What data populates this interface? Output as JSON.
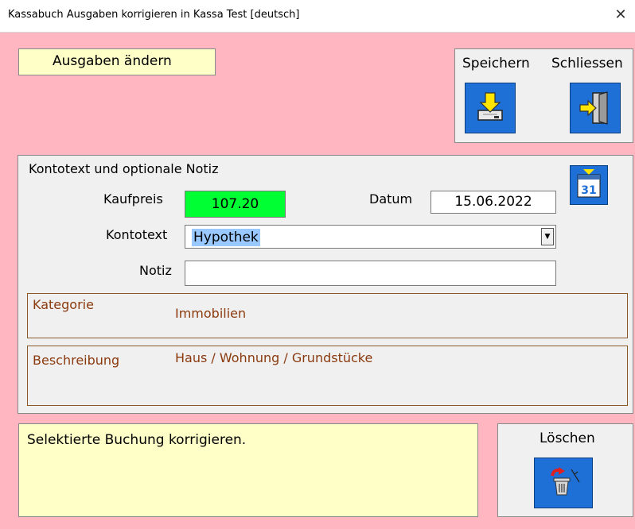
{
  "window": {
    "title": "Kassabuch Ausgaben korrigieren in Kassa Test   [deutsch]",
    "close_symbol": "✕"
  },
  "mode_label": "Ausgaben ändern",
  "buttons": {
    "save_label": "Speichern",
    "close_label": "Schliessen",
    "delete_label": "Löschen"
  },
  "form": {
    "section_title": "Kontotext und optionale Notiz",
    "price_label": "Kaufpreis",
    "price_value": "107.20",
    "date_label": "Datum",
    "date_value": "15.06.2022",
    "account_label": "Kontotext",
    "account_value": "Hypothek",
    "note_label": "Notiz",
    "note_value": ""
  },
  "info": {
    "category_label": "Kategorie",
    "category_value": "Immobilien",
    "description_label": "Beschreibung",
    "description_value": "Haus / Wohnung / Grundstücke"
  },
  "calendar_day": "31",
  "status_message": "Selektierte Buchung korrigieren.",
  "colors": {
    "background": "#ffb6c1",
    "panel": "#f0f0f0",
    "highlight_yellow": "#ffffc8",
    "price_green": "#00ff33",
    "icon_blue": "#1f70d6",
    "info_text": "#8b3a0e"
  },
  "icons": [
    "save-tray-icon",
    "exit-door-icon",
    "calendar-icon",
    "delete-trash-icon",
    "dropdown-arrow-icon",
    "close-icon"
  ]
}
